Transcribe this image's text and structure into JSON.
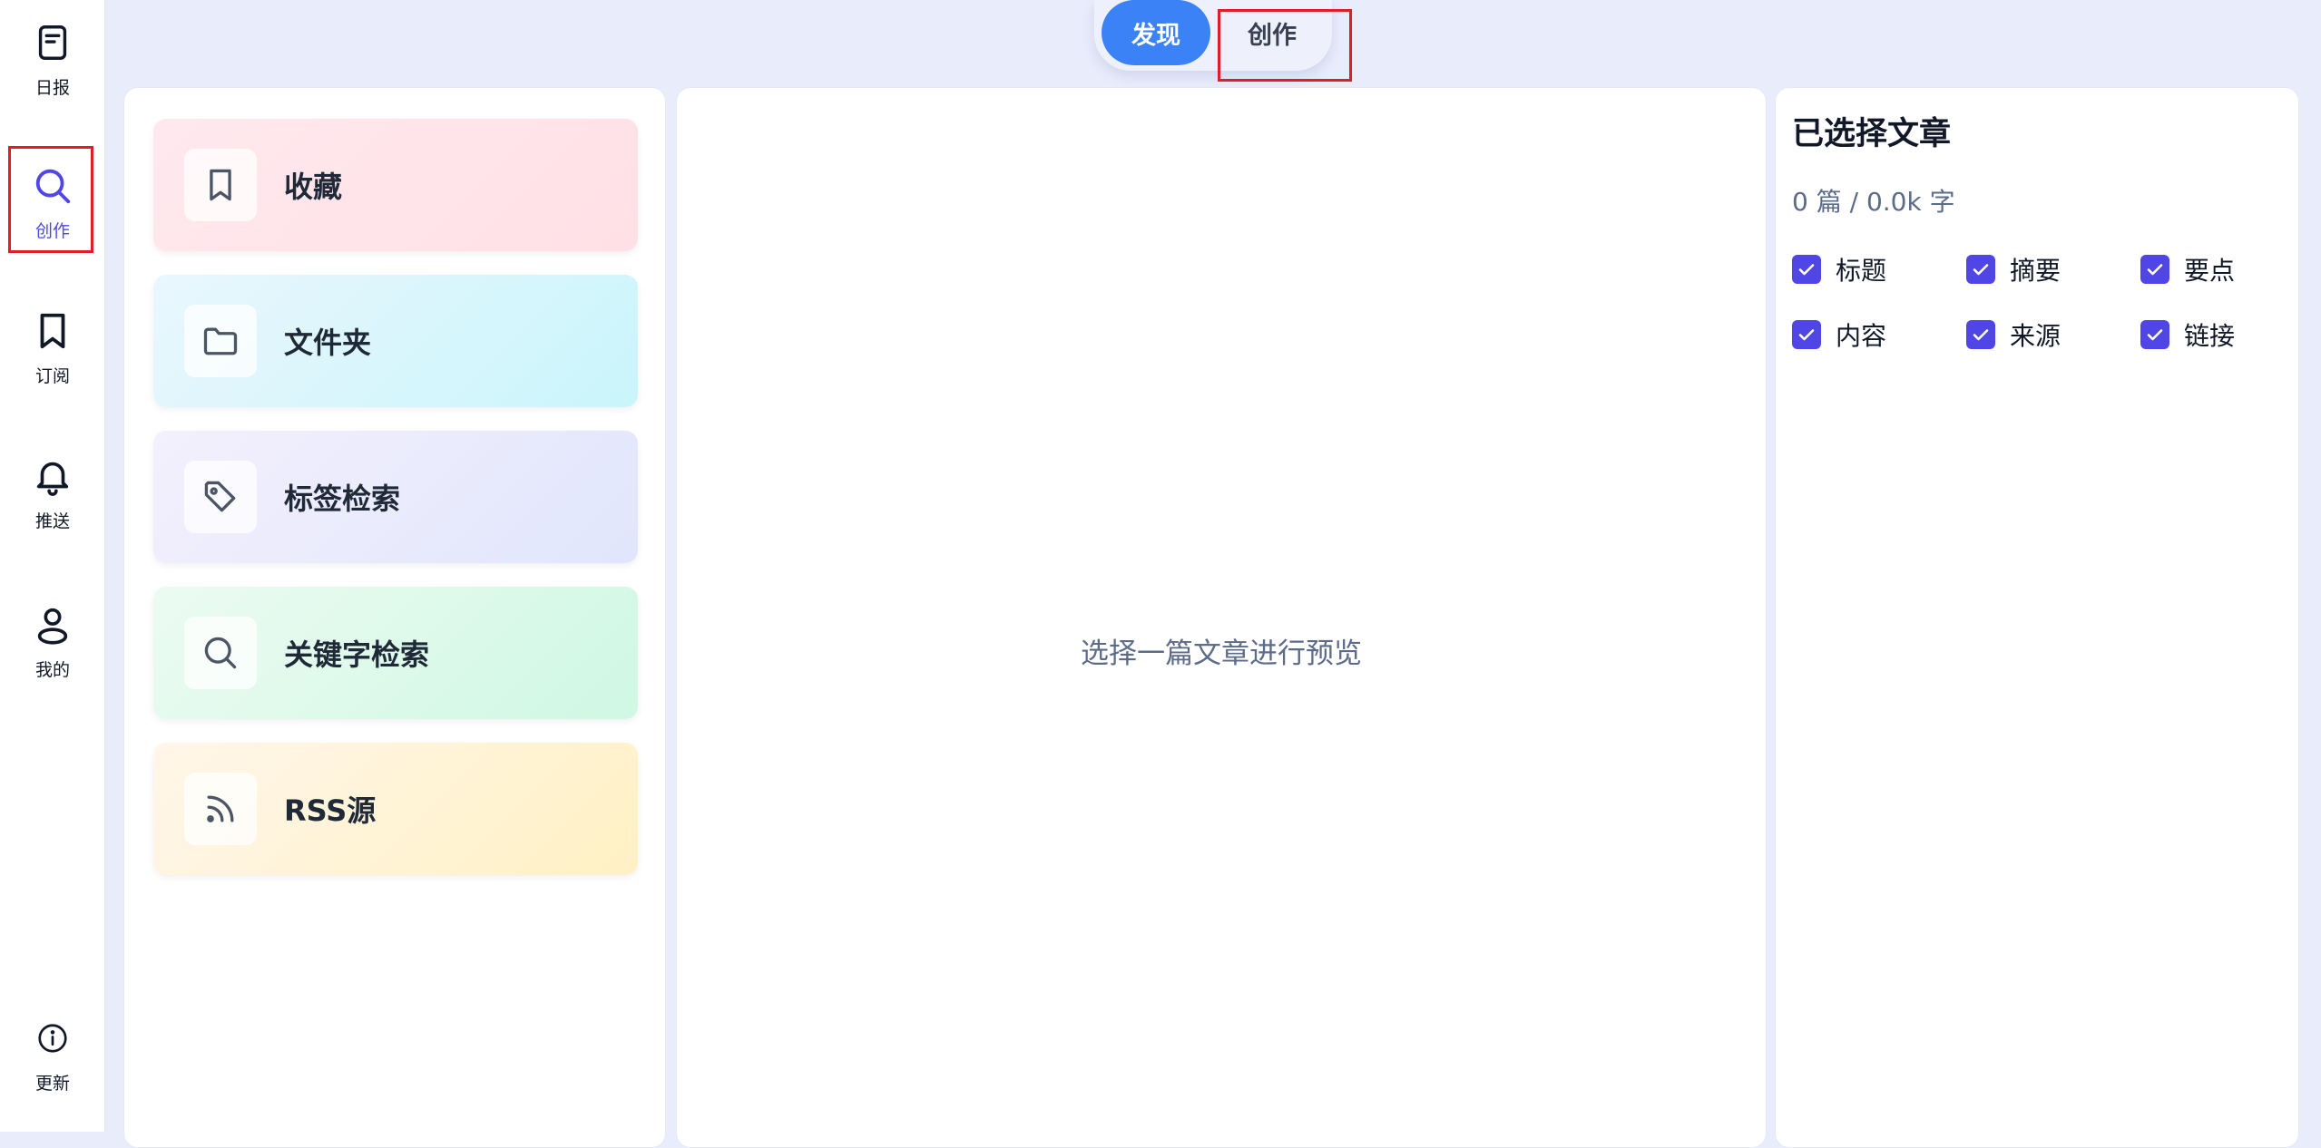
{
  "sidebar": {
    "items": [
      {
        "label": "日报",
        "icon": "newspaper-icon"
      },
      {
        "label": "创作",
        "icon": "search-icon",
        "active": true
      },
      {
        "label": "订阅",
        "icon": "bookmark-icon"
      },
      {
        "label": "推送",
        "icon": "bell-icon"
      },
      {
        "label": "我的",
        "icon": "user-icon"
      }
    ],
    "update": {
      "label": "更新",
      "icon": "info-icon"
    }
  },
  "toggle": {
    "discover": "发现",
    "create": "创作"
  },
  "sources": {
    "items": [
      {
        "label": "收藏",
        "icon": "bookmark-icon",
        "color": "#ffe4ea"
      },
      {
        "label": "文件夹",
        "icon": "folder-icon",
        "color": "#cff7fb"
      },
      {
        "label": "标签检索",
        "icon": "tag-icon",
        "color": "#e4e7fc"
      },
      {
        "label": "关键字检索",
        "icon": "search-icon",
        "color": "#d3f9e6"
      },
      {
        "label": "RSS源",
        "icon": "rss-icon",
        "color": "#fff2cc"
      }
    ]
  },
  "preview": {
    "hint": "选择一篇文章进行预览"
  },
  "selected": {
    "title": "已选择文章",
    "stats": "0 篇 / 0.0k 字",
    "options": [
      {
        "label": "标题",
        "checked": true
      },
      {
        "label": "摘要",
        "checked": true
      },
      {
        "label": "要点",
        "checked": true
      },
      {
        "label": "内容",
        "checked": true
      },
      {
        "label": "来源",
        "checked": true
      },
      {
        "label": "链接",
        "checked": true
      }
    ]
  },
  "colors": {
    "accent": "#4f46e5",
    "primary_button": "#3b82f6",
    "background": "#e8ecfb",
    "highlight_box": "#e11d2a"
  }
}
